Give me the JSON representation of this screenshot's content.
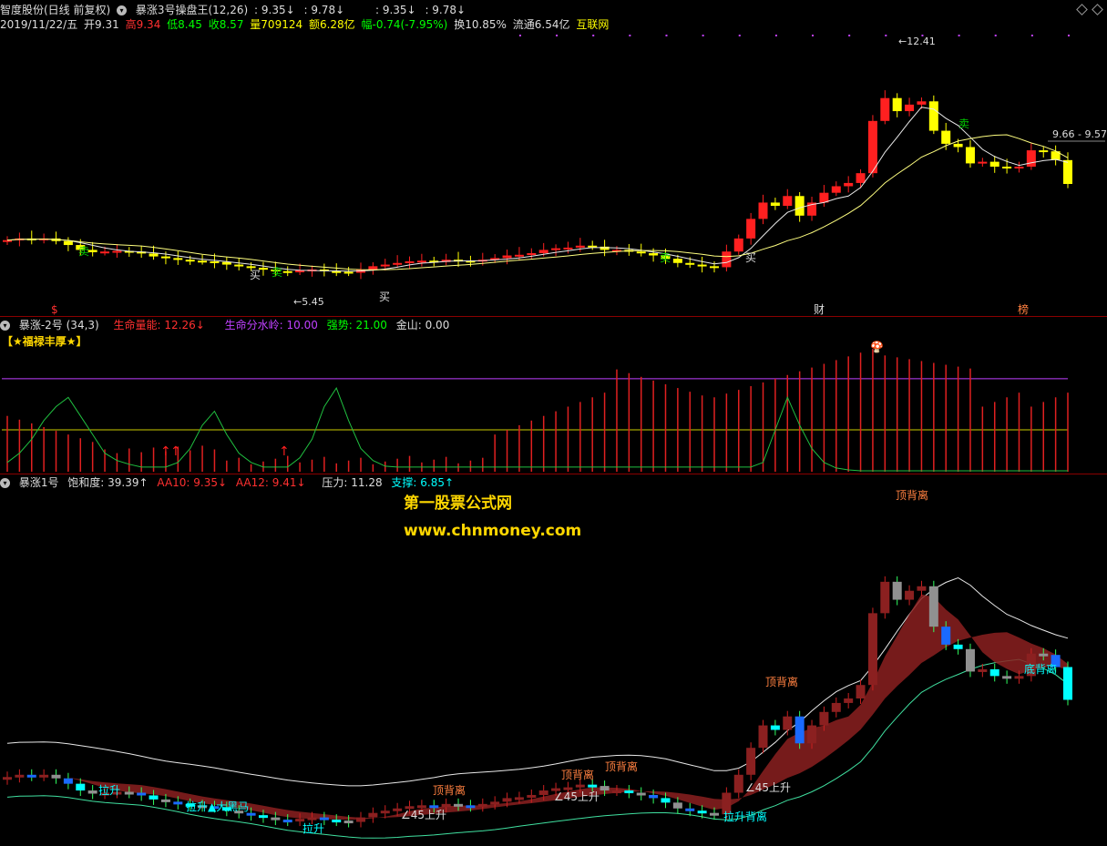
{
  "header": {
    "stock": "智度股份(日线 前复权)",
    "formula_name": "暴涨3号操盘王(12,26)",
    "v1": ": 9.35↓",
    "v2": ": 9.78↓",
    "v3": ": 9.35↓",
    "v4": ": 9.78↓"
  },
  "quote": {
    "date": "2019/11/22/五",
    "open": "开9.31",
    "high": "高9.34",
    "low": "低8.45",
    "close": "收8.57",
    "volume": "量709124",
    "amount": "额6.28亿",
    "change": "幅-0.74(-7.95%)",
    "turnover": "换10.85%",
    "float": "流通6.54亿",
    "sector": "互联网"
  },
  "panel2": {
    "name": "暴涨-2号",
    "params": "(34,3)",
    "life_energy": "生命量能: 12.26↓",
    "watershed": "生命分水岭: 10.00",
    "strength": "强势: 21.00",
    "goldmountain": "金山: 0.00",
    "banner": "【★福禄丰厚★】"
  },
  "panel3": {
    "name": "暴涨1号",
    "saturation": "饱和度: 39.39↑",
    "aa10": "AA10: 9.35↓",
    "aa12": "AA12: 9.41↓",
    "pressure": "压力: 11.28",
    "support": "支撑: 6.85↑"
  },
  "watermark": {
    "line1": "第一股票公式网",
    "line2": "www.chnmoney.com"
  },
  "colors": {
    "up": "#ff2020",
    "down": "#ffff00",
    "cyan": "#00ffff",
    "white": "#ffffff",
    "purple": "#c040ff",
    "green": "#00cc00",
    "darkred": "#8b2020",
    "darkgreen": "#0a6a3a",
    "blue": "#1a6aff"
  },
  "chart_data": [
    {
      "type": "candlestick",
      "title": "暴涨3号操盘王(12,26)",
      "price_range": [
        5.0,
        13.2
      ],
      "annotations": {
        "high": "←12.41",
        "low": "←5.45",
        "right": "9.66 - 9.57",
        "marks": [
          "$",
          "财",
          "榜"
        ],
        "buy": "买",
        "sell": "卖"
      },
      "close": [
        6.85,
        6.9,
        6.88,
        6.9,
        6.82,
        6.7,
        6.55,
        6.48,
        6.5,
        6.52,
        6.5,
        6.44,
        6.35,
        6.3,
        6.25,
        6.22,
        6.2,
        6.18,
        6.1,
        6.05,
        6.0,
        5.95,
        5.9,
        5.88,
        5.92,
        5.95,
        5.9,
        5.88,
        5.85,
        5.95,
        6.05,
        6.1,
        6.15,
        6.2,
        6.22,
        6.18,
        6.25,
        6.22,
        6.2,
        6.25,
        6.3,
        6.38,
        6.4,
        6.45,
        6.55,
        6.6,
        6.62,
        6.68,
        6.65,
        6.55,
        6.55,
        6.5,
        6.45,
        6.38,
        6.28,
        6.15,
        6.1,
        6.05,
        6.02,
        6.5,
        6.9,
        7.5,
        8.0,
        7.9,
        8.2,
        7.6,
        8.0,
        8.3,
        8.5,
        8.6,
        8.9,
        10.5,
        11.2,
        10.8,
        11.0,
        11.1,
        10.2,
        9.8,
        9.7,
        9.2,
        9.25,
        9.1,
        9.05,
        9.1,
        9.6,
        9.57,
        9.3,
        8.57
      ],
      "series": [
        {
          "name": "",
          "desc": "fast MA"
        },
        {
          "name": "",
          "desc": "slow MA"
        }
      ]
    },
    {
      "type": "bar",
      "title": "暴涨-2号(34,3)",
      "ylim": [
        0,
        140
      ],
      "line_levels": [
        10.0,
        21.0,
        100.0
      ]
    },
    {
      "type": "candlestick",
      "title": "暴涨1号",
      "annotations": [
        "拉升",
        "拉升▲大黑马",
        "拉升",
        "顶背离",
        "∠45上升",
        "顶背离",
        "顶背离",
        "∠45上升",
        "顶背离",
        "拉升背离",
        "∠45上升",
        "顶背离",
        "底背离"
      ]
    }
  ]
}
